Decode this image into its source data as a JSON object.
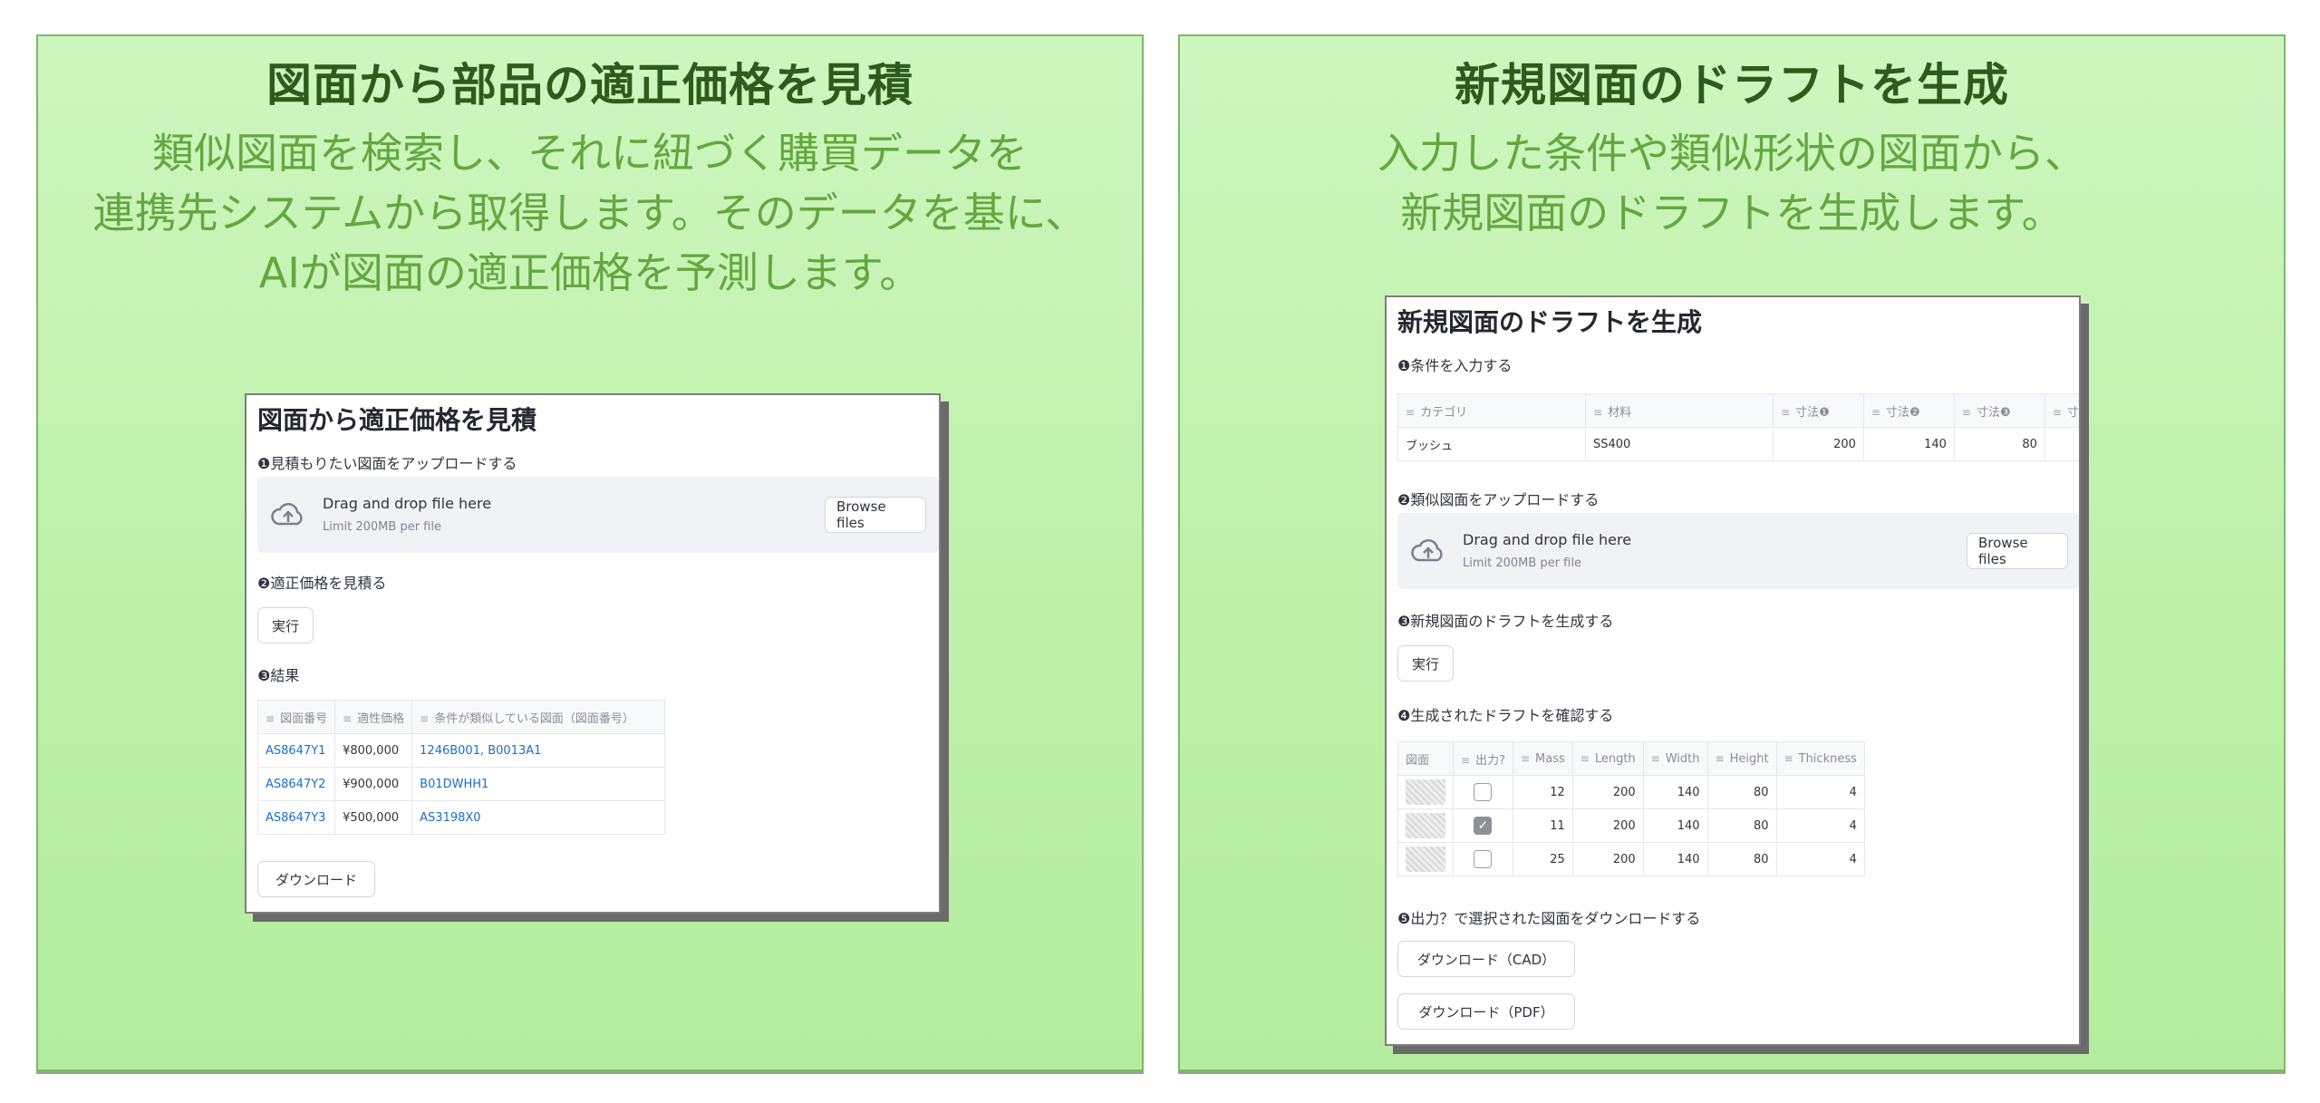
{
  "left": {
    "title": "図面から部品の適正価格を見積",
    "description": "類似図面を検索し、それに紐づく購買データを\n連携先システムから取得します。そのデータを基に、\nAIが図面の適正価格を予測します。",
    "app": {
      "title": "図面から適正価格を見積",
      "step1": "❶見積もりたい図面をアップロードする",
      "upload": {
        "drag_text": "Drag and drop file here",
        "limit": "Limit 200MB per file",
        "browse": "Browse files"
      },
      "step2": "❷適正価格を見積る",
      "run": "実行",
      "step3": "❸結果",
      "table": {
        "headers": [
          "図面番号",
          "適性価格",
          "条件が類似している図面（図面番号）"
        ],
        "rows": [
          [
            "AS8647Y1",
            "¥800,000",
            "1246B001, B0013A1"
          ],
          [
            "AS8647Y2",
            "¥900,000",
            "B01DWHH1"
          ],
          [
            "AS8647Y3",
            "¥500,000",
            "AS3198X0"
          ]
        ]
      },
      "download": "ダウンロード"
    }
  },
  "right": {
    "title": "新規図面のドラフトを生成",
    "description": "入力した条件や類似形状の図面から、\n新規図面のドラフトを生成します。",
    "app": {
      "title": "新規図面のドラフトを生成",
      "step1": "❶条件を入力する",
      "cond_table": {
        "headers": [
          "カテゴリ",
          "材料",
          "寸法❶",
          "寸法❷",
          "寸法❸",
          "寸"
        ],
        "row": [
          "ブッシュ",
          "SS400",
          "200",
          "140",
          "80",
          ""
        ]
      },
      "step2": "❷類似図面をアップロードする",
      "upload": {
        "drag_text": "Drag and drop file here",
        "limit": "Limit 200MB per file",
        "browse": "Browse files"
      },
      "step3": "❸新規図面のドラフトを生成する",
      "run": "実行",
      "step4": "❹生成されたドラフトを確認する",
      "draft_table": {
        "headers": [
          "図面",
          "出力?",
          "Mass",
          "Length",
          "Width",
          "Height",
          "Thickness"
        ],
        "rows": [
          {
            "checked": false,
            "mass": "12",
            "length": "200",
            "width": "140",
            "height": "80",
            "thickness": "4"
          },
          {
            "checked": true,
            "mass": "11",
            "length": "200",
            "width": "140",
            "height": "80",
            "thickness": "4"
          },
          {
            "checked": false,
            "mass": "25",
            "length": "200",
            "width": "140",
            "height": "80",
            "thickness": "4"
          }
        ]
      },
      "step5": "❺出力？で選択された図面をダウンロードする",
      "download_cad": "ダウンロード（CAD）",
      "download_pdf": "ダウンロード（PDF）"
    }
  }
}
